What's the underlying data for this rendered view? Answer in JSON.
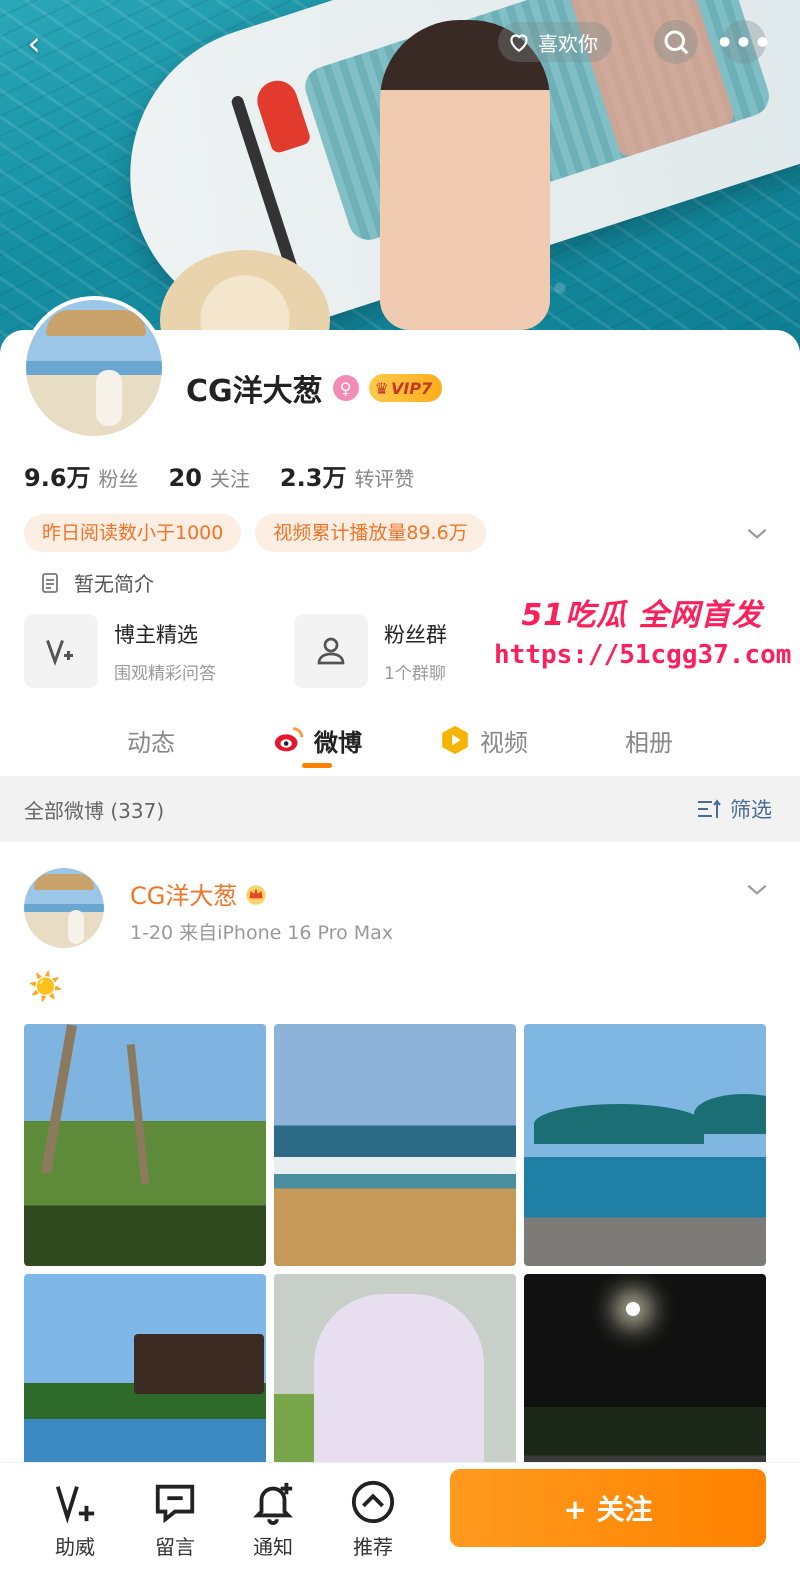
{
  "topbar": {
    "like_label": "喜欢你"
  },
  "profile": {
    "name": "CG洋大葱",
    "vip_label": "VIP7",
    "stats": [
      {
        "num": "9.6万",
        "label": "粉丝"
      },
      {
        "num": "20",
        "label": "关注"
      },
      {
        "num": "2.3万",
        "label": "转评赞"
      }
    ],
    "tags": [
      "昨日阅读数小于1000",
      "视频累计播放量89.6万"
    ],
    "bio": "暂无简介",
    "features": [
      {
        "title": "博主精选",
        "sub": "围观精彩问答",
        "icon": "v-plus-icon"
      },
      {
        "title": "粉丝群",
        "sub": "1个群聊",
        "icon": "group-icon"
      }
    ]
  },
  "watermark": {
    "brand": "51吃瓜 全网首发",
    "url": "https://51cgg37.com"
  },
  "tabs": [
    {
      "label": "动态",
      "active": false
    },
    {
      "label": "微博",
      "active": true
    },
    {
      "label": "视频",
      "active": false
    },
    {
      "label": "相册",
      "active": false
    }
  ],
  "feed": {
    "count_label": "全部微博 (337)",
    "filter_label": "筛选"
  },
  "post": {
    "author": "CG洋大葱",
    "meta": "1-20  来自iPhone 16 Pro Max",
    "text": "☀️"
  },
  "bottom_bar": {
    "items": [
      {
        "label": "助威",
        "icon": "v-plus-icon"
      },
      {
        "label": "留言",
        "icon": "message-icon"
      },
      {
        "label": "通知",
        "icon": "bell-plus-icon"
      },
      {
        "label": "推荐",
        "icon": "chevron-up-circle-icon"
      }
    ],
    "follow_label": "+ 关注"
  },
  "colors": {
    "accent": "#ff8200",
    "name_orange": "#f07528",
    "watermark": "#ff1f5a"
  }
}
